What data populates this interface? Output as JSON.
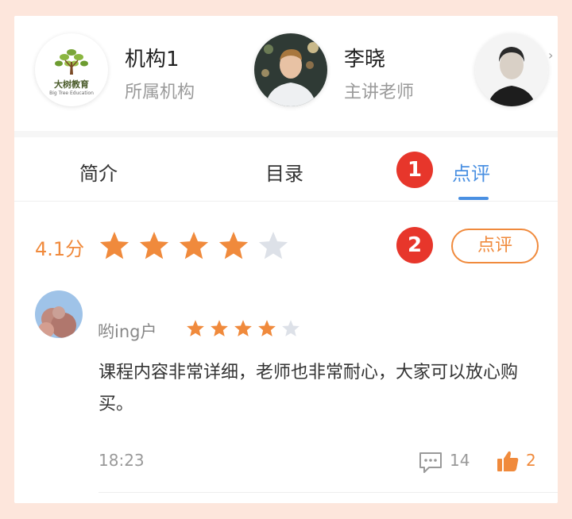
{
  "people": [
    {
      "name": "机构1",
      "role": "所属机构",
      "logo_title": "大树教育",
      "logo_sub": "Big Tree Education"
    },
    {
      "name": "李晓",
      "role": "主讲老师"
    }
  ],
  "tabs": [
    {
      "label": "简介",
      "active": false
    },
    {
      "label": "目录",
      "active": false
    },
    {
      "label": "点评",
      "active": true
    }
  ],
  "annotations": [
    "1",
    "2"
  ],
  "rating": {
    "score_text": "4.1分",
    "stars": 4,
    "max_stars": 5
  },
  "review_button": {
    "label": "点评"
  },
  "review": {
    "user": "哟ing户",
    "stars": 4,
    "max_stars": 5,
    "text": "课程内容非常详细，老师也非常耐心，大家可以放心购买。",
    "time": "18:23",
    "comments": "14",
    "likes": "2"
  },
  "colors": {
    "accent": "#f08a3c",
    "tab_active": "#4a90e2",
    "badge": "#e7362b",
    "star_empty": "#dde1e8"
  },
  "icons": [
    "comment-icon",
    "thumbs-up-icon",
    "star-icon"
  ]
}
